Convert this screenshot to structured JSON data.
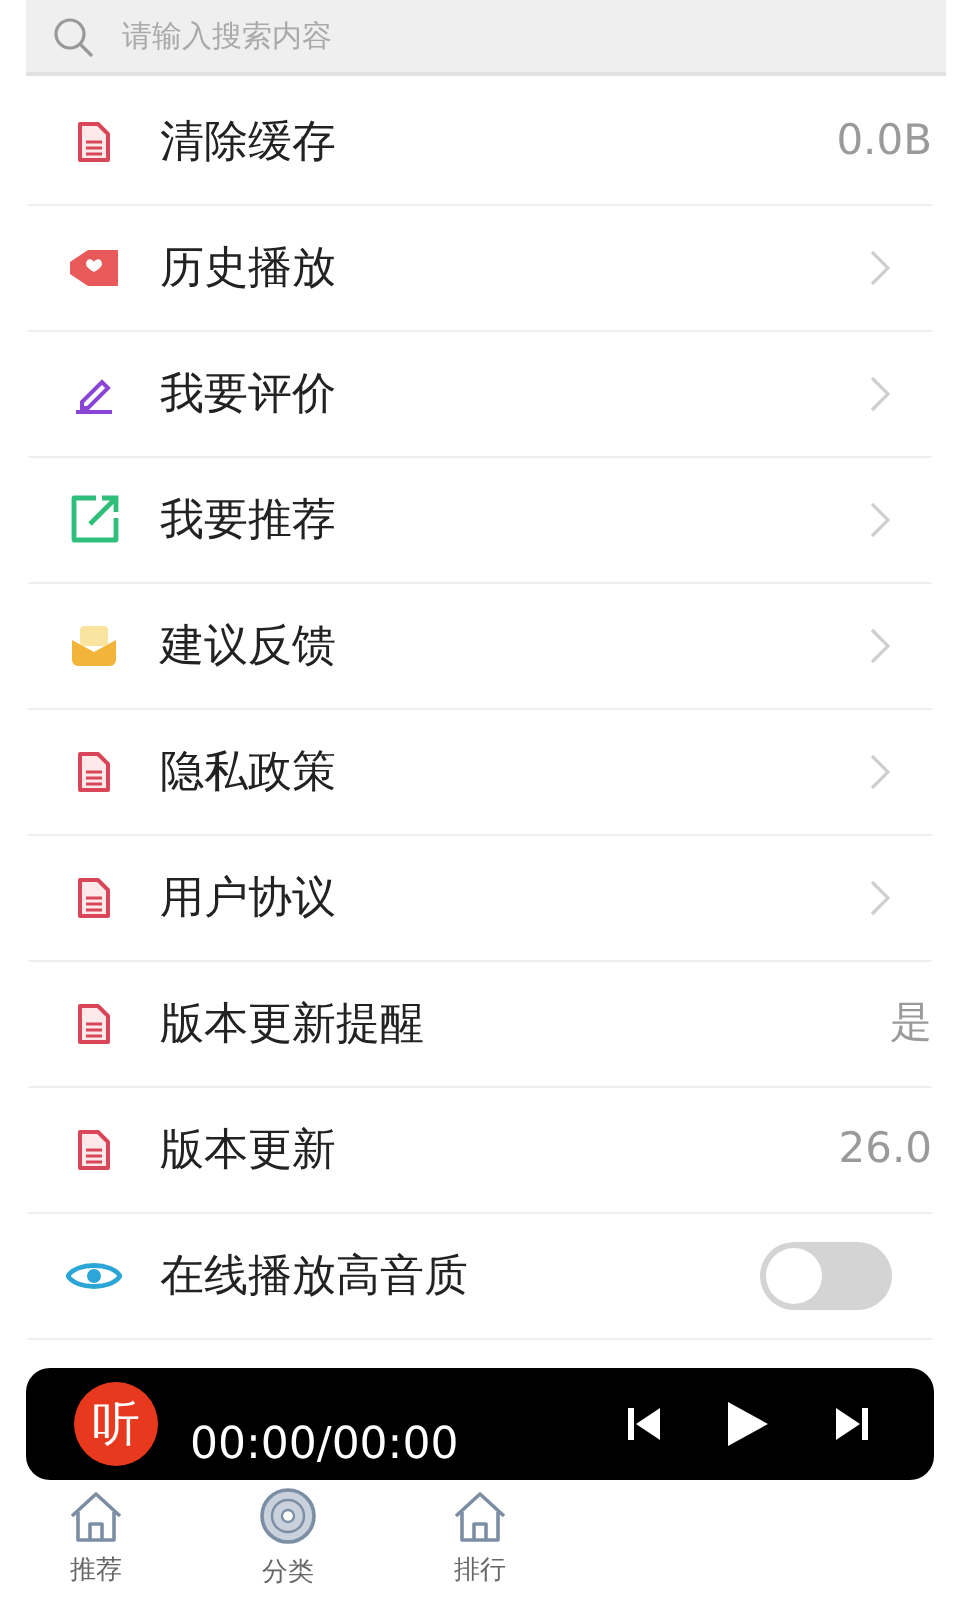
{
  "search": {
    "placeholder": "请输入搜索内容"
  },
  "settings": [
    {
      "kind": "value",
      "label": "清除缓存",
      "value": "0.0B"
    },
    {
      "kind": "chevron",
      "label": "历史播放"
    },
    {
      "kind": "chevron",
      "label": "我要评价"
    },
    {
      "kind": "chevron",
      "label": "我要推荐"
    },
    {
      "kind": "chevron",
      "label": "建议反馈"
    },
    {
      "kind": "chevron",
      "label": "隐私政策"
    },
    {
      "kind": "chevron",
      "label": "用户协议"
    },
    {
      "kind": "value",
      "label": "版本更新提醒",
      "value": "是"
    },
    {
      "kind": "value",
      "label": "版本更新",
      "value": "26.0"
    },
    {
      "kind": "toggle",
      "label": "在线播放高音质",
      "on": false
    }
  ],
  "player": {
    "logo": "听",
    "time": "00:00/00:00"
  },
  "tabs": [
    {
      "label": "推荐"
    },
    {
      "label": "分类"
    },
    {
      "label": "排行"
    }
  ]
}
